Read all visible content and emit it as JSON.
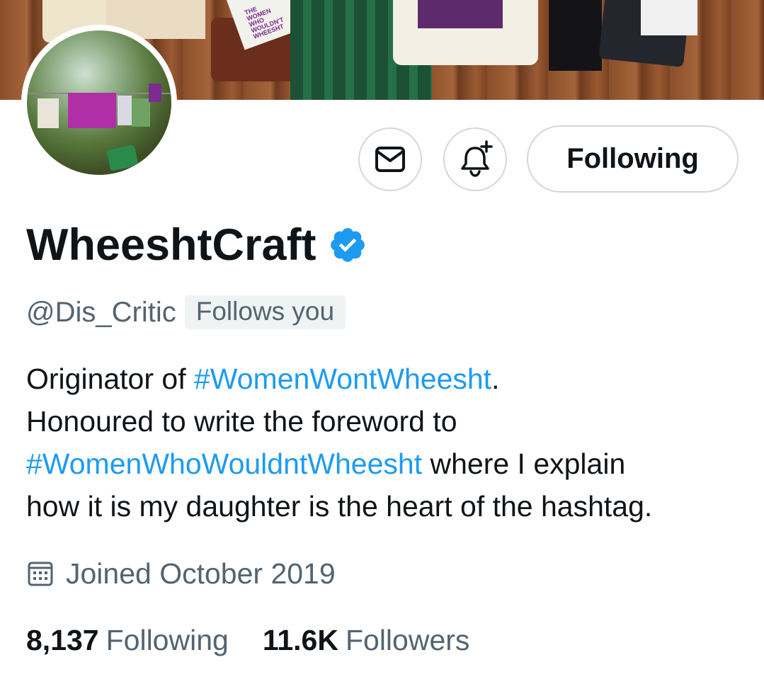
{
  "profile": {
    "display_name": "WheeshtCraft",
    "verified": true,
    "handle": "@Dis_Critic",
    "follows_you_badge": "Follows you",
    "bio": {
      "line1_text": "Originator of ",
      "line1_tag": "#WomenWontWheesht",
      "line1_end": ".",
      "line2_text": "Honoured to write the foreword to",
      "line3_tag": "#WomenWhoWouldntWheesht",
      "line3_text": " where I explain",
      "line4_text": "how it is my daughter is the heart of the hashtag."
    },
    "joined": "Joined October 2019",
    "following_count": "8,137",
    "following_label": "Following",
    "followers_count": "11.6K",
    "followers_label": "Followers"
  },
  "banner": {
    "book_text": "THE WOMEN WHO WOULDN'T WHEESHT"
  },
  "actions": {
    "message_icon": "envelope-icon",
    "notify_icon": "bell-plus-icon",
    "following_label": "Following"
  },
  "colors": {
    "accent": "#1d9bf0",
    "secondary_text": "#536471",
    "primary_text": "#0f1419",
    "border": "#cfd9de"
  }
}
